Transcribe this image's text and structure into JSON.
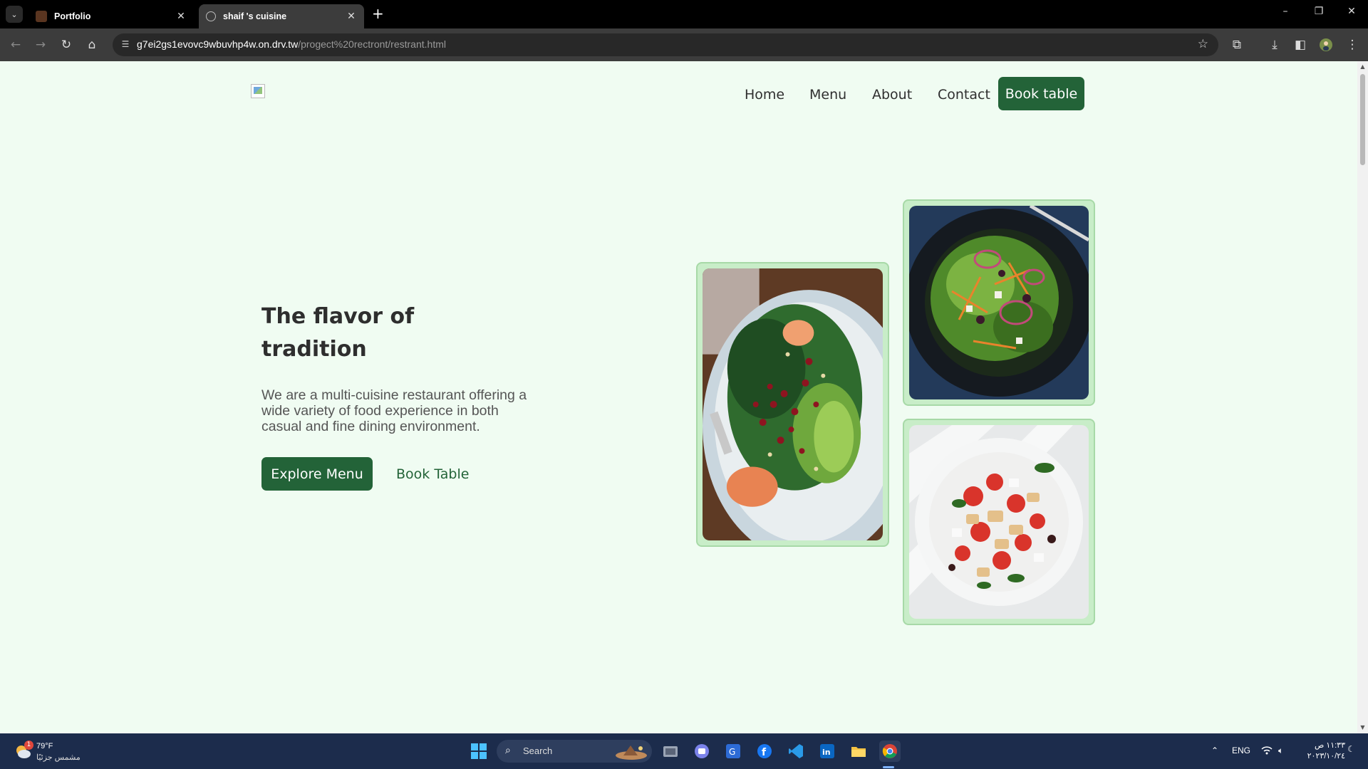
{
  "browser": {
    "tabs": [
      {
        "title": "Portfolio",
        "active": false
      },
      {
        "title": "shaif 's cuisine",
        "active": true
      }
    ],
    "url_host": "g7ei2gs1evovc9wbuvhp4w.on.drv.tw",
    "url_path": "/progect%20rectront/restrant.html"
  },
  "site": {
    "nav": {
      "home": "Home",
      "menu": "Menu",
      "about": "About",
      "contact": "Contact",
      "book_table": "Book table"
    },
    "hero": {
      "title_line1": "The flavor of",
      "title_line2": "tradition",
      "description": "We are a multi-cuisine restaurant offering a wide variety of food experience in both casual and fine dining environment.",
      "explore_button": "Explore Menu",
      "book_link": "Book Table"
    },
    "colors": {
      "background": "#f0fcf2",
      "accent": "#236338",
      "frame": "#c8edc8"
    }
  },
  "taskbar": {
    "weather_temp": "79°F",
    "weather_desc": "مشمس جزئيًا",
    "weather_badge": "1",
    "search_label": "Search",
    "language": "ENG",
    "time": "١١:٣٣ ص",
    "date": "٢٠٢٣/١٠/٢٤"
  }
}
